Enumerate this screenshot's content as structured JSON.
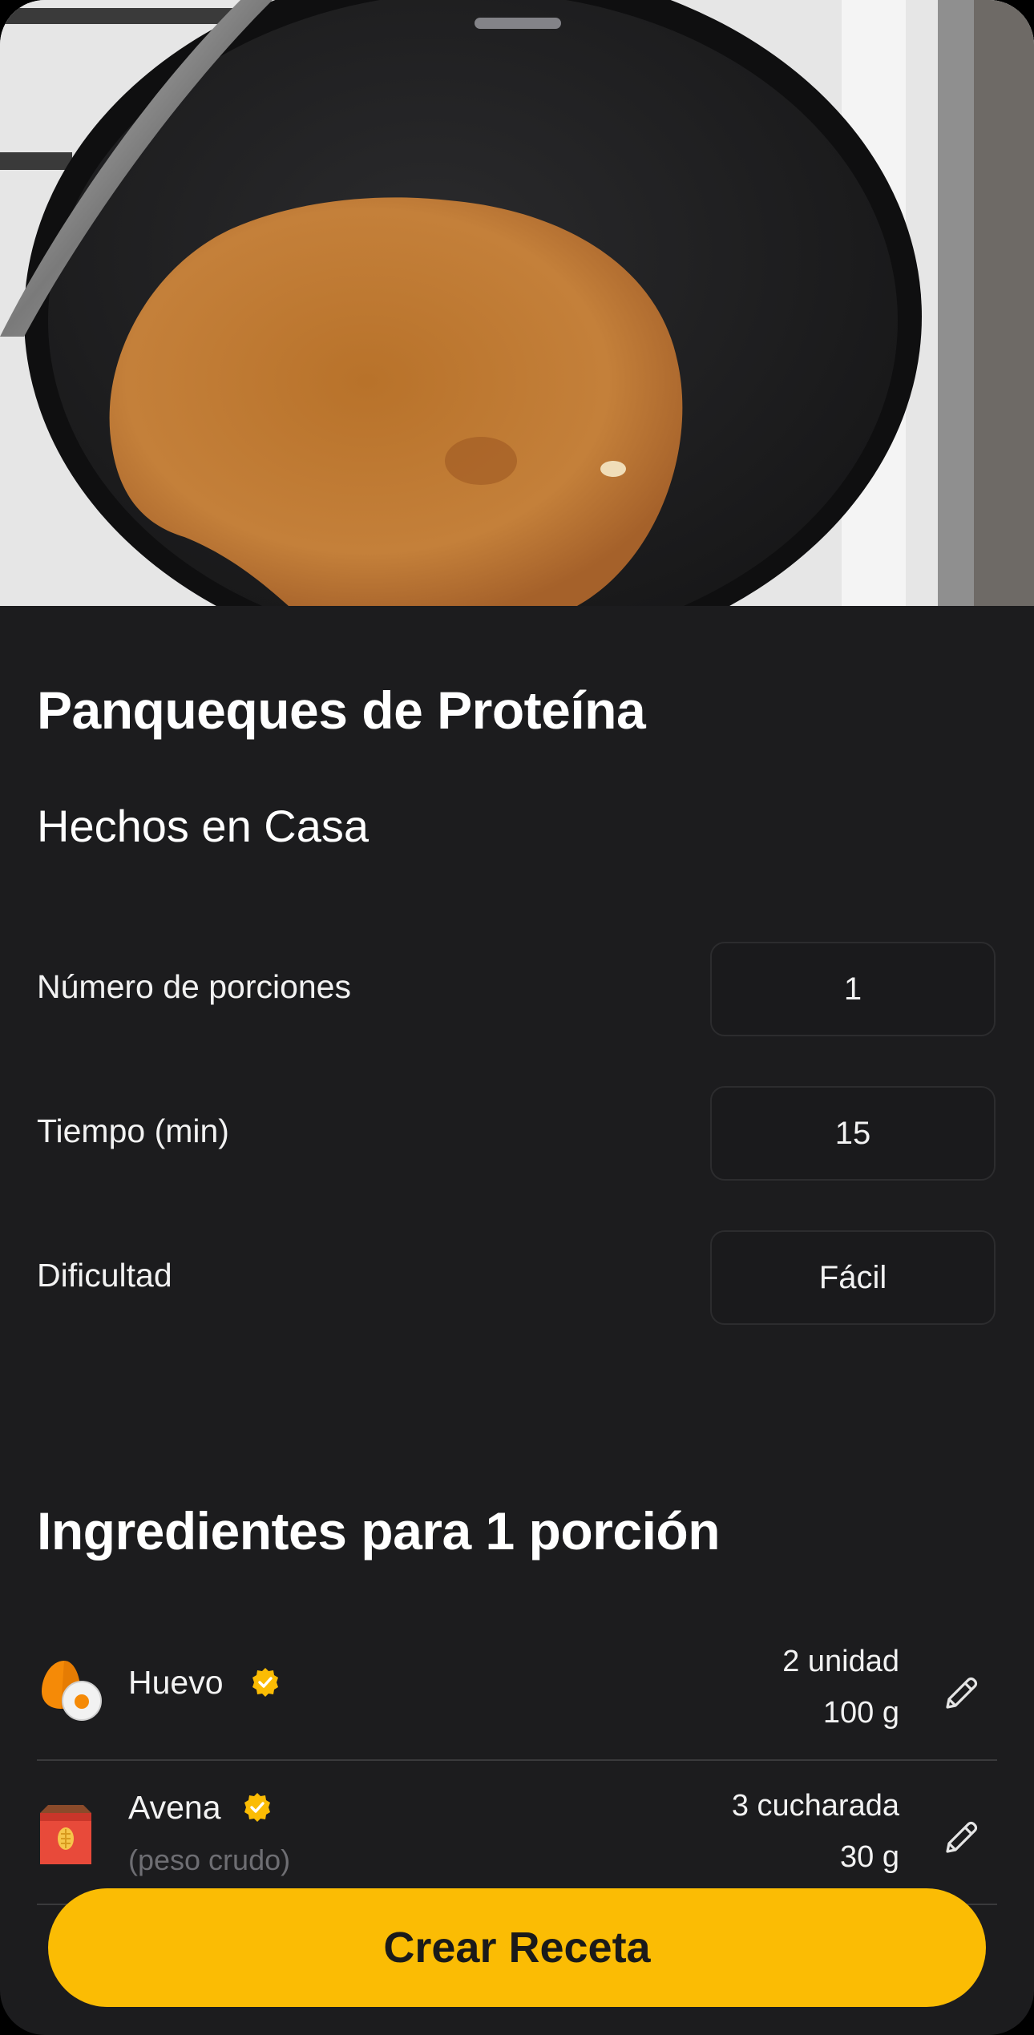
{
  "recipe": {
    "title": "Panqueques de Proteína",
    "subtitle": "Hechos en Casa"
  },
  "details": [
    {
      "label": "Número de porciones",
      "value": "1"
    },
    {
      "label": "Tiempo (min)",
      "value": "15"
    },
    {
      "label": "Dificultad",
      "value": "Fácil"
    }
  ],
  "ingredients": {
    "heading": "Ingredientes para 1 porción",
    "items": [
      {
        "name": "Huevo",
        "icon": "egg-icon",
        "verified": true,
        "note": "",
        "amount": "2 unidad",
        "weight": "100 g"
      },
      {
        "name": "Avena",
        "icon": "oats-box-icon",
        "verified": true,
        "note": "(peso crudo)",
        "amount": "3 cucharada",
        "weight": "30 g"
      }
    ]
  },
  "actions": {
    "create_label": "Crear Receta"
  },
  "colors": {
    "accent": "#fbbc04",
    "background": "#1c1c1e"
  }
}
